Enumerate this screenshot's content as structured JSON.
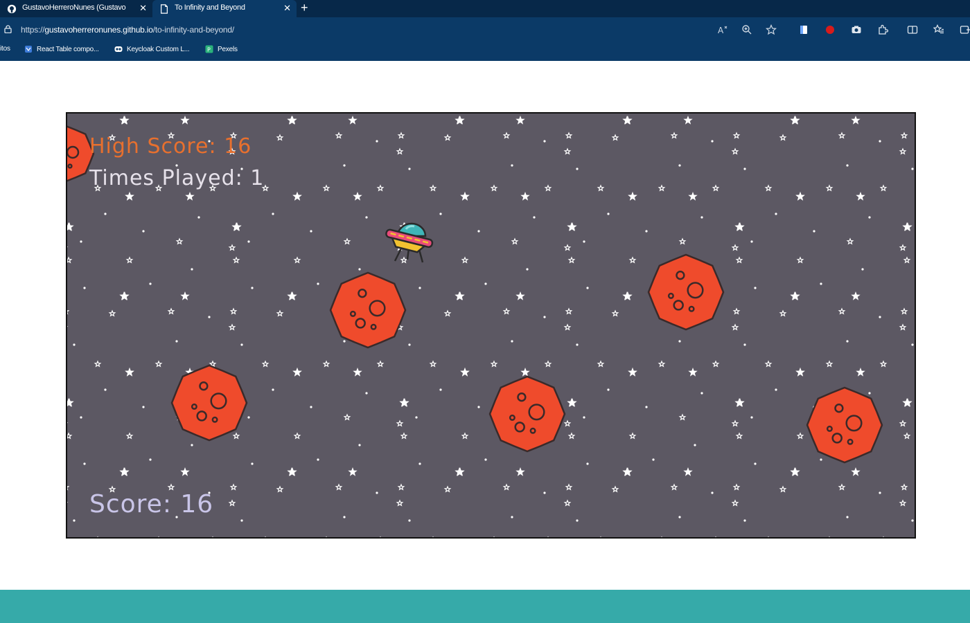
{
  "browser": {
    "tabs": [
      {
        "title": "GustavoHerreroNunes (Gustavo",
        "icon": "github-icon"
      },
      {
        "title": "To Infinity and Beyond",
        "icon": "page-icon"
      }
    ],
    "address": {
      "scheme": "https://",
      "host": "gustavoherreronunes.github.io",
      "path": "/to-infinity-and-beyond/"
    },
    "bookmarks": [
      {
        "label": "itos",
        "icon": ""
      },
      {
        "label": "React Table compo...",
        "icon": "react-icon"
      },
      {
        "label": "Keycloak Custom L...",
        "icon": "keycloak-icon"
      },
      {
        "label": "Pexels",
        "icon": "pexels-icon"
      }
    ],
    "toolbar_icons": [
      "read-aloud-icon",
      "zoom-icon",
      "favorite-star-icon",
      "extension-icon",
      "record-icon",
      "camera-icon",
      "extensions-icon",
      "split-screen-icon",
      "favorites-icon",
      "collections-icon"
    ]
  },
  "game": {
    "hud": {
      "high_score_label": "High Score: 16",
      "times_played_label": "Times Played: 1",
      "score_label": "Score: 16"
    },
    "colors": {
      "sky": "#5c5863",
      "star": "#ffffff",
      "meteor_fill": "#ef4b2c",
      "meteor_outline": "#3a2a2a",
      "high_score_text": "#e8702e",
      "times_played_text": "#e6e1ea",
      "score_text": "#c9c5e8",
      "ufo_dome": "#3fb5b8",
      "ufo_band": "#e94b7a",
      "ufo_body": "#f2c230"
    }
  },
  "page": {
    "footer_color": "#36aaa9",
    "chrome_color": "#0b3a67",
    "tabstrip_color": "#072849"
  }
}
